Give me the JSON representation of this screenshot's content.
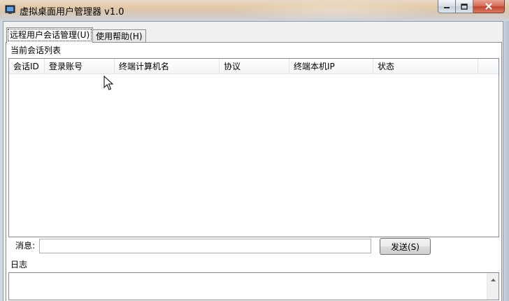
{
  "window": {
    "title": "虚拟桌面用户管理器 v1.0"
  },
  "tabs": [
    {
      "label": "远程用户会话管理(U)",
      "active": true
    },
    {
      "label": "使用帮助(H)",
      "active": false
    }
  ],
  "sessions": {
    "group_label": "当前会话列表",
    "columns": [
      "会话ID",
      "登录账号",
      "终端计算机名",
      "协议",
      "终端本机IP",
      "状态"
    ],
    "rows": []
  },
  "message": {
    "label": "消息:",
    "value": "",
    "send_label": "发送(S)"
  },
  "log": {
    "group_label": "日志",
    "content": ""
  },
  "colors": {
    "close_button": "#c2432c",
    "panel_background": "#ffffff",
    "client_background": "#f0f0f0"
  }
}
